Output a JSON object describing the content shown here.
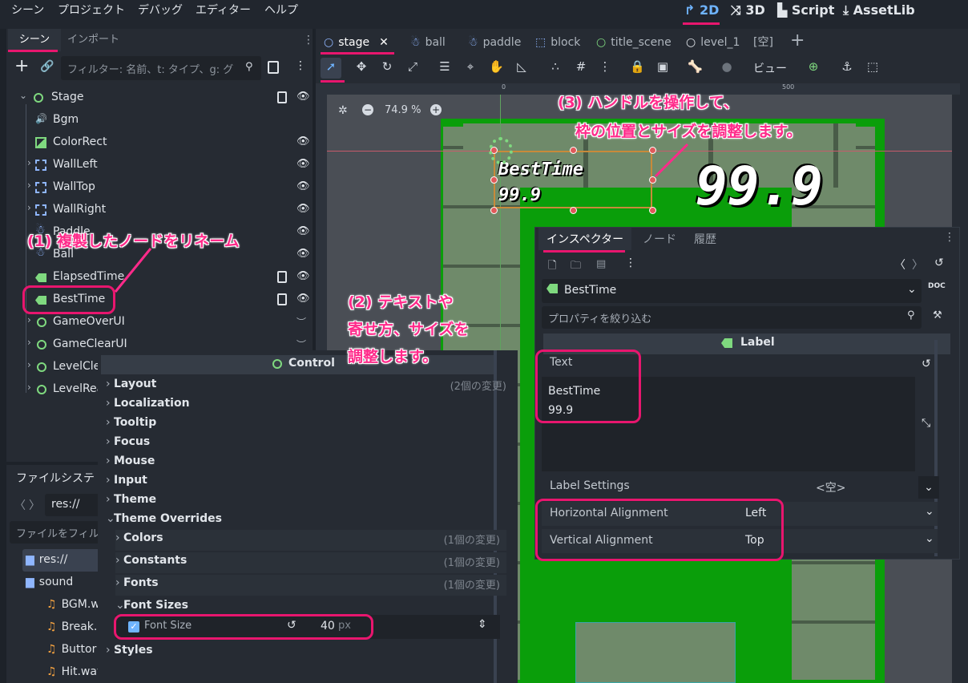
{
  "menu": [
    "シーン",
    "プロジェクト",
    "デバッグ",
    "エディター",
    "ヘルプ"
  ],
  "modes": [
    {
      "label": "2D",
      "icon": "2d-icon",
      "active": true
    },
    {
      "label": "3D",
      "icon": "3d-icon",
      "active": false
    },
    {
      "label": "Script",
      "icon": "script-icon",
      "active": false
    },
    {
      "label": "AssetLib",
      "icon": "assetlib-icon",
      "active": false
    }
  ],
  "scene_dock": {
    "tabs": [
      "シーン",
      "インポート"
    ],
    "filter_placeholder": "フィルター: 名前、t: タイプ、g: グ",
    "nodes": [
      {
        "name": "Stage",
        "icon": "control-icon"
      },
      {
        "name": "Bgm",
        "icon": "audio-icon"
      },
      {
        "name": "ColorRect",
        "icon": "colorrect-icon"
      },
      {
        "name": "WallLeft",
        "icon": "staticbody-icon"
      },
      {
        "name": "WallTop",
        "icon": "staticbody-icon"
      },
      {
        "name": "WallRight",
        "icon": "staticbody-icon"
      },
      {
        "name": "Paddle",
        "icon": "characterbody-icon"
      },
      {
        "name": "Ball",
        "icon": "characterbody-icon"
      },
      {
        "name": "ElapsedTime",
        "icon": "label-icon"
      },
      {
        "name": "BestTime",
        "icon": "label-icon"
      },
      {
        "name": "GameOverUI",
        "icon": "control-icon"
      },
      {
        "name": "GameClearUI",
        "icon": "control-icon"
      },
      {
        "name": "LevelCle",
        "icon": "control-icon"
      },
      {
        "name": "LevelRea",
        "icon": "control-icon"
      }
    ]
  },
  "filesystem": {
    "title": "ファイルシステ",
    "path": "res://",
    "filter_placeholder": "ファイルをフィル",
    "items": [
      "res://",
      "sound",
      "BGM.w",
      "Break.",
      "Buttor",
      "Hit.wav"
    ]
  },
  "scene_tabs": [
    "stage",
    "ball",
    "paddle",
    "block",
    "title_scene",
    "level_1",
    "[空]"
  ],
  "viewport": {
    "zoom": "74.9 %",
    "ruler_0": "0",
    "ruler_500": "500",
    "view_label": "ビュー",
    "score_text": "99.9",
    "label_lines": [
      "BestTime",
      "99.9"
    ]
  },
  "inspector": {
    "tabs": [
      "インスペクター",
      "ノード",
      "履歴"
    ],
    "node_name": "BestTime",
    "filter_placeholder": "プロパティを絞り込む",
    "class_header": "Label",
    "text_label": "Text",
    "text_lines": [
      "BestTime",
      "99.9"
    ],
    "label_settings_label": "Label Settings",
    "label_settings_value": "<空>",
    "h_align_label": "Horizontal Alignment",
    "h_align_value": "Left",
    "v_align_label": "Vertical Alignment",
    "v_align_value": "Top"
  },
  "control_panel": {
    "header": "Control",
    "rows": [
      {
        "label": "Layout",
        "changes": "(2個の変更)"
      },
      {
        "label": "Localization",
        "changes": ""
      },
      {
        "label": "Tooltip",
        "changes": ""
      },
      {
        "label": "Focus",
        "changes": ""
      },
      {
        "label": "Mouse",
        "changes": ""
      },
      {
        "label": "Input",
        "changes": ""
      },
      {
        "label": "Theme",
        "changes": ""
      },
      {
        "label": "Theme Overrides",
        "changes": ""
      }
    ],
    "sub_rows": [
      {
        "label": "Colors",
        "changes": "(1個の変更)"
      },
      {
        "label": "Constants",
        "changes": "(1個の変更)"
      },
      {
        "label": "Fonts",
        "changes": "(1個の変更)"
      },
      {
        "label": "Font Sizes",
        "changes": ""
      }
    ],
    "font_size_label": "Font Size",
    "font_size_value": "40",
    "font_size_unit": "px",
    "styles_label": "Styles"
  },
  "annotations": {
    "step1": "(1) 複製したノードをリネーム",
    "step2_lines": [
      "(2) テキストや",
      "寄せ方、サイズを",
      "調整します。"
    ],
    "step3_lines": [
      "(3) ハンドルを操作して、",
      "枠の位置とサイズを調整します。"
    ]
  },
  "colors": {
    "accent": "#6fb4ff",
    "callout": "#e8166e",
    "bg_green": "#0a9e0a",
    "panel": "#262b33"
  }
}
